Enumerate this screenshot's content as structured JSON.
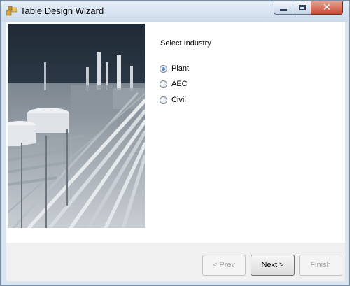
{
  "window": {
    "title": "Table Design Wizard"
  },
  "industry": {
    "label": "Select Industry",
    "options": [
      {
        "label": "Plant",
        "checked": true
      },
      {
        "label": "AEC",
        "checked": false
      },
      {
        "label": "Civil",
        "checked": false
      }
    ]
  },
  "buttons": {
    "prev": "< Prev",
    "next": "Next >",
    "finish": "Finish"
  },
  "icons": {
    "app": "wizard-app-icon",
    "minimize": "minimize-icon",
    "maximize": "maximize-icon",
    "close": "close-icon"
  },
  "colors": {
    "title_bar": "#d4e1ef",
    "close_button": "#c84a33",
    "radio_selected": "#1d5a9c"
  }
}
